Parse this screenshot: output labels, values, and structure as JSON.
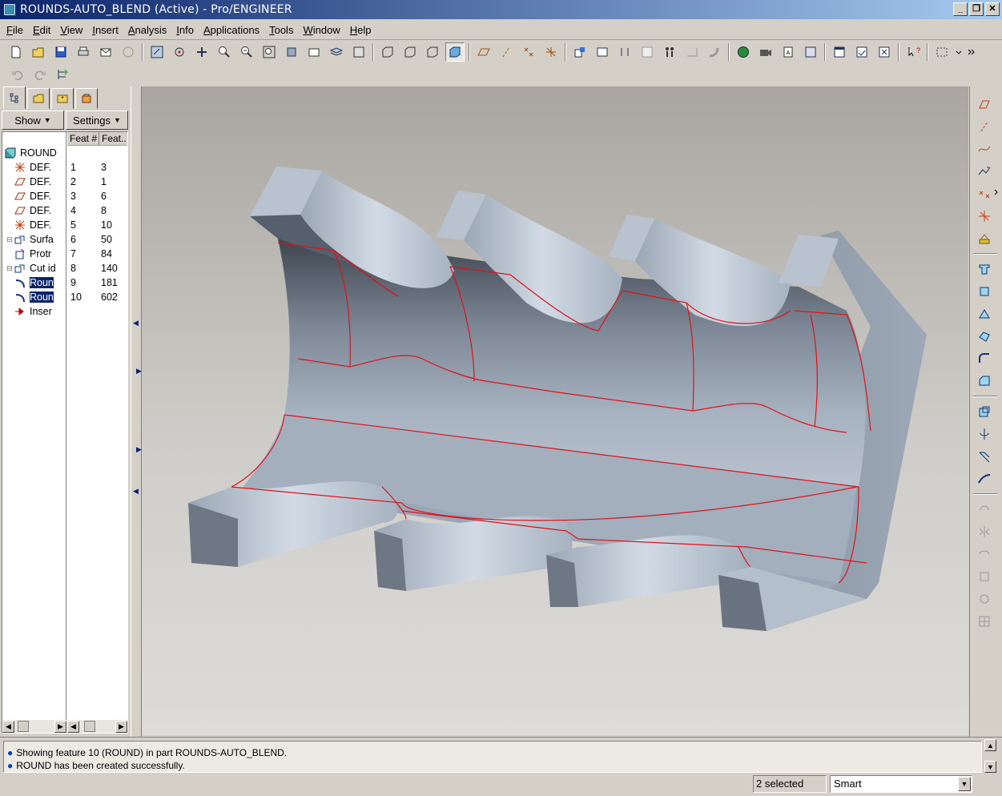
{
  "window": {
    "title": "ROUNDS-AUTO_BLEND (Active) - Pro/ENGINEER",
    "minimize": "_",
    "restore": "❐",
    "close": "✕"
  },
  "menu": [
    "File",
    "Edit",
    "View",
    "Insert",
    "Analysis",
    "Info",
    "Applications",
    "Tools",
    "Window",
    "Help"
  ],
  "navigator": {
    "show_label": "Show",
    "settings_label": "Settings",
    "col_feat_num": "Feat #",
    "col_feat_id": "Feat..",
    "root": "ROUND",
    "items": [
      {
        "name": "DEF.",
        "num": "1",
        "id": "3",
        "icon": "csys-icon",
        "expand": ""
      },
      {
        "name": "DEF.",
        "num": "2",
        "id": "1",
        "icon": "datum-plane-icon",
        "expand": ""
      },
      {
        "name": "DEF.",
        "num": "3",
        "id": "6",
        "icon": "datum-plane-icon",
        "expand": ""
      },
      {
        "name": "DEF.",
        "num": "4",
        "id": "8",
        "icon": "datum-plane-icon",
        "expand": ""
      },
      {
        "name": "DEF.",
        "num": "5",
        "id": "10",
        "icon": "csys-icon",
        "expand": ""
      },
      {
        "name": "Surfa",
        "num": "6",
        "id": "50",
        "icon": "surface-icon",
        "expand": "⊟"
      },
      {
        "name": "Protr",
        "num": "7",
        "id": "84",
        "icon": "protrusion-icon",
        "expand": ""
      },
      {
        "name": "Cut id",
        "num": "8",
        "id": "140",
        "icon": "cut-icon",
        "expand": "⊟"
      },
      {
        "name": "Roun",
        "num": "9",
        "id": "181",
        "icon": "round-icon",
        "expand": "",
        "selected": true
      },
      {
        "name": "Roun",
        "num": "10",
        "id": "602",
        "icon": "round-icon",
        "expand": "",
        "selected": true
      },
      {
        "name": "Inser",
        "num": "",
        "id": "",
        "icon": "insert-here-icon",
        "expand": ""
      }
    ]
  },
  "messages": [
    "Showing feature 10 (ROUND) in part ROUNDS-AUTO_BLEND.",
    "ROUND has been created successfully."
  ],
  "status": {
    "selected": "2 selected",
    "filter": "Smart"
  },
  "colors": {
    "titlebar_start": "#0a246a",
    "titlebar_end": "#a6caf0",
    "selection": "#0a246a",
    "edge_highlight": "#e0101a",
    "model_surface": "#a8b4c2"
  }
}
